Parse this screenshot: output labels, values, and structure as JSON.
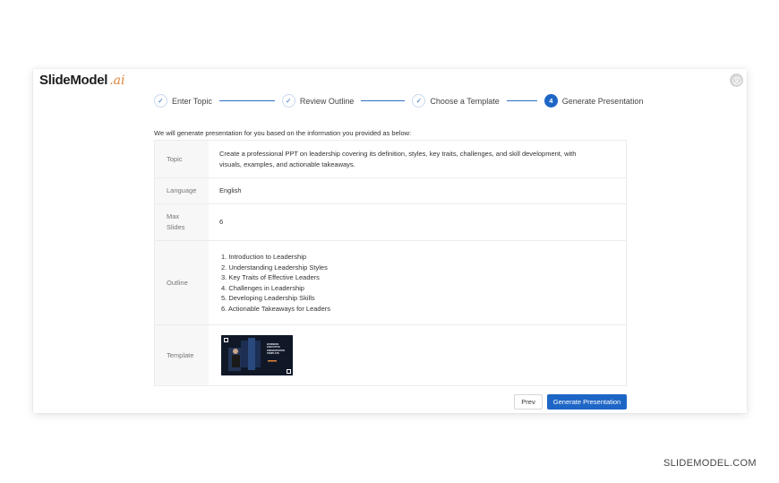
{
  "app": {
    "logo_main": "SlideModel",
    "logo_ai": ".ai"
  },
  "stepper": {
    "steps": [
      {
        "label": "Enter Topic",
        "state": "done"
      },
      {
        "label": "Review Outline",
        "state": "done"
      },
      {
        "label": "Choose a Template",
        "state": "done"
      },
      {
        "label": "Generate Presentation",
        "state": "active",
        "number": "4"
      }
    ]
  },
  "intro": "We will generate presentation for you based on the information you provided as below:",
  "summary": {
    "topic_label": "Topic",
    "topic_value": "Create a professional PPT on leadership covering its definition, styles, key traits, challenges, and skill development, with visuals, examples, and actionable takeaways.",
    "language_label": "Language",
    "language_value": "English",
    "max_slides_label": "Max Slides",
    "max_slides_value": "6",
    "outline_label": "Outline",
    "outline_items": [
      "1. Introduction to Leadership",
      "2. Understanding Leadership Styles",
      "3. Key Traits of Effective Leaders",
      "4. Challenges in Leadership",
      "5. Developing Leadership Skills",
      "6. Actionable Takeaways for Leaders"
    ],
    "template_label": "Template",
    "template_thumb_text": "BUSINESS EXECUTIVE PRESENTATION TEMPLATE"
  },
  "buttons": {
    "prev": "Prev",
    "generate": "Generate Presentation"
  },
  "watermark": "SLIDEMODEL.COM",
  "colors": {
    "accent": "#1e66c6",
    "logo_ai": "#e0853a"
  }
}
